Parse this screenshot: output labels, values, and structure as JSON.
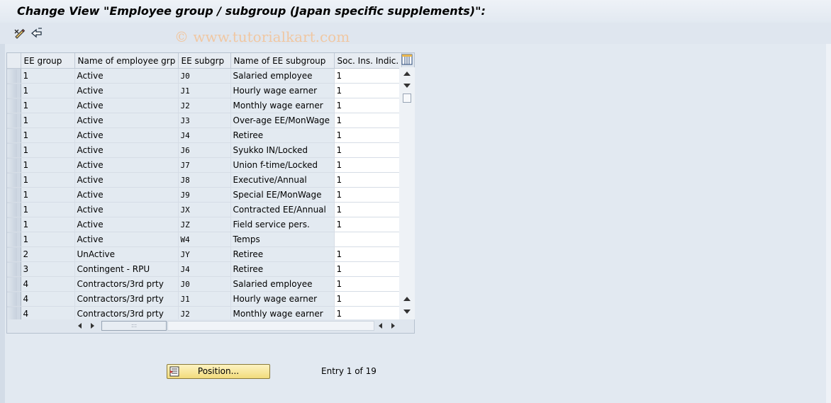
{
  "window": {
    "title": "Change View \"Employee group / subgroup (Japan specific supplements)\":"
  },
  "toolbar": {
    "icons": [
      "edit-icon",
      "other-view-icon"
    ]
  },
  "watermark": "© www.tutorialkart.com",
  "table": {
    "columns": [
      "EE group",
      "Name of employee grp",
      "EE subgrp",
      "Name of EE subgroup",
      "Soc. Ins. Indic."
    ],
    "rows": [
      [
        "1",
        "Active",
        "J0",
        "Salaried employee",
        "1"
      ],
      [
        "1",
        "Active",
        "J1",
        "Hourly wage earner",
        "1"
      ],
      [
        "1",
        "Active",
        "J2",
        "Monthly wage earner",
        "1"
      ],
      [
        "1",
        "Active",
        "J3",
        "Over-age EE/MonWage",
        "1"
      ],
      [
        "1",
        "Active",
        "J4",
        "Retiree",
        "1"
      ],
      [
        "1",
        "Active",
        "J6",
        "Syukko IN/Locked",
        "1"
      ],
      [
        "1",
        "Active",
        "J7",
        "Union f-time/Locked",
        "1"
      ],
      [
        "1",
        "Active",
        "J8",
        "Executive/Annual",
        "1"
      ],
      [
        "1",
        "Active",
        "J9",
        "Special EE/MonWage",
        "1"
      ],
      [
        "1",
        "Active",
        "JX",
        "Contracted EE/Annual",
        "1"
      ],
      [
        "1",
        "Active",
        "JZ",
        "Field service pers.",
        "1"
      ],
      [
        "1",
        "Active",
        "W4",
        "Temps",
        ""
      ],
      [
        "2",
        "UnActive",
        "JY",
        "Retiree",
        "1"
      ],
      [
        "3",
        "Contingent - RPU",
        "J4",
        "Retiree",
        "1"
      ],
      [
        "4",
        "Contractors/3rd prty",
        "J0",
        "Salaried employee",
        "1"
      ],
      [
        "4",
        "Contractors/3rd prty",
        "J1",
        "Hourly wage earner",
        "1"
      ],
      [
        "4",
        "Contractors/3rd prty",
        "J2",
        "Monthly wage earner",
        "1"
      ]
    ],
    "horizontal_thumb_text": ":::"
  },
  "footer": {
    "position_button_label": "Position...",
    "entry_text": "Entry 1 of 19"
  },
  "colors": {
    "button_yellow": "#f2dc7c",
    "background": "#dfe6ef",
    "watermark": "#f0c7a2"
  }
}
